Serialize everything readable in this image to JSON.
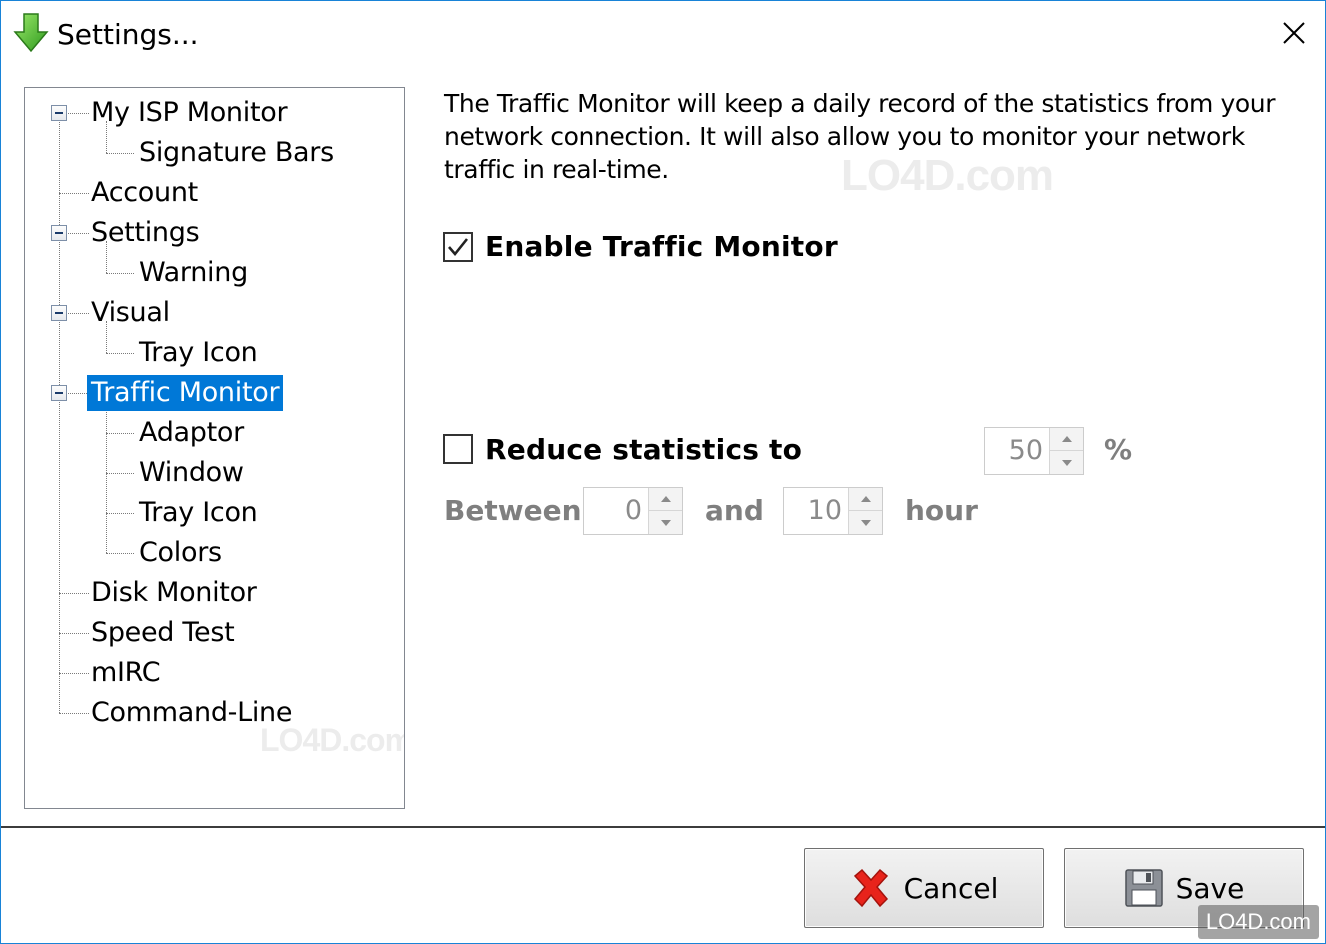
{
  "window": {
    "title": "Settings...",
    "accent": "#1883d7"
  },
  "tree": {
    "selected_color": "#0078d7",
    "items": [
      {
        "label": "My ISP Monitor",
        "level": 0,
        "expander": "minus"
      },
      {
        "label": "Signature Bars",
        "level": 1
      },
      {
        "label": "Account",
        "level": 0
      },
      {
        "label": "Settings",
        "level": 0,
        "expander": "minus"
      },
      {
        "label": "Warning",
        "level": 1
      },
      {
        "label": "Visual",
        "level": 0,
        "expander": "minus"
      },
      {
        "label": "Tray Icon",
        "level": 1
      },
      {
        "label": "Traffic Monitor",
        "level": 0,
        "expander": "minus",
        "selected": true
      },
      {
        "label": "Adaptor",
        "level": 1
      },
      {
        "label": "Window",
        "level": 1
      },
      {
        "label": "Tray Icon",
        "level": 1
      },
      {
        "label": "Colors",
        "level": 1
      },
      {
        "label": "Disk Monitor",
        "level": 0
      },
      {
        "label": "Speed Test",
        "level": 0
      },
      {
        "label": "mIRC",
        "level": 0
      },
      {
        "label": "Command-Line",
        "level": 0
      }
    ]
  },
  "panel": {
    "description": "The Traffic Monitor will keep a daily record of the statistics from your network connection. It will also allow you to monitor your network traffic in real-time.",
    "enable_label": "Enable Traffic Monitor",
    "enable_checked": true,
    "reduce_label": "Reduce statistics to",
    "reduce_checked": false,
    "reduce_value": "50",
    "reduce_unit": "%",
    "between_label": "Between",
    "between_from": "0",
    "and_label": "and",
    "between_to": "10",
    "hour_label": "hour"
  },
  "footer": {
    "cancel_label": "Cancel",
    "save_label": "Save"
  },
  "watermarks": {
    "main": "LO4D.com",
    "corner": "LO4D.com"
  }
}
